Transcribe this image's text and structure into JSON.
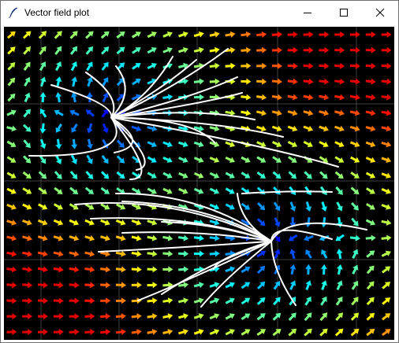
{
  "window": {
    "title": "Vector field plot",
    "icon": "feather-icon",
    "controls": [
      "minimize-icon",
      "maximize-icon",
      "close-icon"
    ]
  },
  "plot": {
    "background": "#000000",
    "grid_color": "#d0d0d0",
    "streamline_color": "#ffffff",
    "colormap": "jet",
    "critical_points": [
      {
        "kind": "source",
        "x": -0.45,
        "y": 0.42
      },
      {
        "kind": "sink",
        "x": 0.37,
        "y": -0.37
      }
    ],
    "grid": true
  }
}
